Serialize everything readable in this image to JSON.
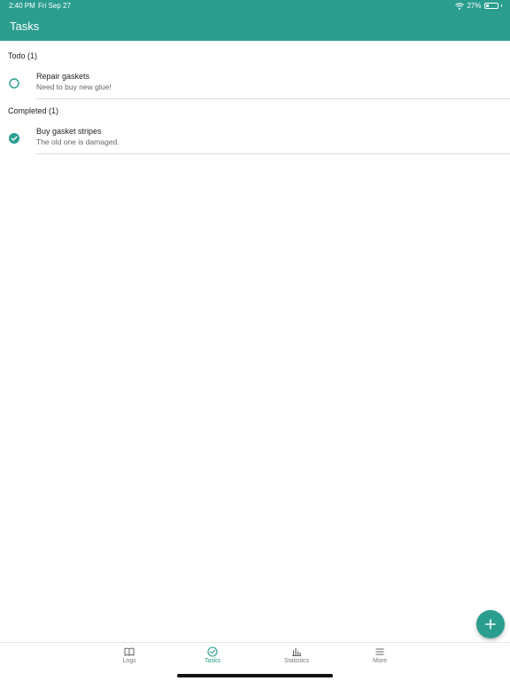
{
  "status_bar": {
    "time": "2:40 PM",
    "date": "Fri Sep 27",
    "battery_text": "27%",
    "battery_level": 0.27
  },
  "header": {
    "title": "Tasks"
  },
  "sections": [
    {
      "label": "Todo (1)",
      "tasks": [
        {
          "title": "Repair gaskets",
          "note": "Need to buy new glue!",
          "completed": false
        }
      ]
    },
    {
      "label": "Completed (1)",
      "tasks": [
        {
          "title": "Buy gasket stripes",
          "note": "The old one is damaged.",
          "completed": true
        }
      ]
    }
  ],
  "fab": {
    "icon": "plus-icon"
  },
  "tabs": [
    {
      "label": "Logs",
      "icon": "book-icon",
      "active": false
    },
    {
      "label": "Tasks",
      "icon": "check-circle-icon",
      "active": true
    },
    {
      "label": "Statistics",
      "icon": "bar-chart-icon",
      "active": false
    },
    {
      "label": "More",
      "icon": "menu-icon",
      "active": false
    }
  ],
  "colors": {
    "accent": "#2a9d8f",
    "header_bg": "#2a9d8f",
    "inactive_tab": "#777777",
    "divider": "#dcdcdc"
  }
}
